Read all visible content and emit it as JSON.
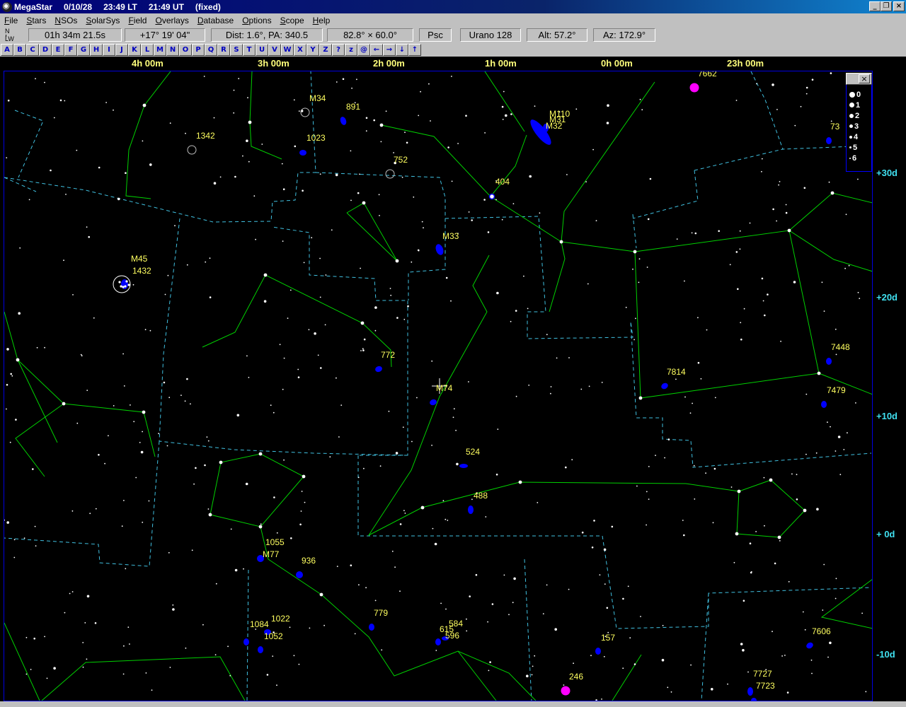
{
  "titlebar": {
    "app": "MegaStar",
    "date": "0/10/28",
    "local_time": "23:49 LT",
    "ut_time": "21:49 UT",
    "mode": "(fixed)",
    "minimize": "_",
    "restore": "❐",
    "close": "×"
  },
  "menu": [
    {
      "label": "File",
      "u": "F",
      "rest": "ile"
    },
    {
      "label": "Stars",
      "u": "S",
      "rest": "tars"
    },
    {
      "label": "NSOs",
      "u": "N",
      "rest": "SOs"
    },
    {
      "label": "SolarSys",
      "u": "S",
      "rest": "olarSys"
    },
    {
      "label": "Field",
      "u": "F",
      "rest": "ield"
    },
    {
      "label": "Overlays",
      "u": "O",
      "rest": "verlays"
    },
    {
      "label": "Database",
      "u": "D",
      "rest": "atabase"
    },
    {
      "label": "Options",
      "u": "O",
      "rest": "ptions"
    },
    {
      "label": "Scope",
      "u": "S",
      "rest": "cope"
    },
    {
      "label": "Help",
      "u": "H",
      "rest": "elp"
    }
  ],
  "status": {
    "compass_n": "N",
    "compass_lw": "LW",
    "ra": "01h 34m 21.5s",
    "dec": "+17° 19' 04\"",
    "dist": "Dist: 1.6°, PA: 340.5",
    "fov": "82.8° × 60.0°",
    "constellation": "Psc",
    "atlas": "Urano 128",
    "alt": "Alt: 57.2°",
    "az": "Az: 172.9°"
  },
  "alpha_buttons": [
    "A",
    "B",
    "C",
    "D",
    "E",
    "F",
    "G",
    "H",
    "I",
    "J",
    "K",
    "L",
    "M",
    "N",
    "O",
    "P",
    "Q",
    "R",
    "S",
    "T",
    "U",
    "V",
    "W",
    "X",
    "Y",
    "Z",
    "?",
    "z",
    "@",
    "←",
    "→",
    "↓",
    "↑"
  ],
  "ra_labels": [
    "4h 00m",
    "3h 00m",
    "2h 00m",
    "1h 00m",
    "0h 00m",
    "23h 00m"
  ],
  "dec_labels": [
    "+30d",
    "+20d",
    "+10d",
    "+ 0d",
    "-10d"
  ],
  "magnitude_legend": [
    "0",
    "1",
    "2",
    "3",
    "4",
    "5",
    "6"
  ],
  "objects": [
    {
      "label": "7662"
    },
    {
      "label": "M34"
    },
    {
      "label": "891"
    },
    {
      "label": "M110"
    },
    {
      "label": "M31"
    },
    {
      "label": "M32"
    },
    {
      "label": "1342"
    },
    {
      "label": "1023"
    },
    {
      "label": "752"
    },
    {
      "label": "404"
    },
    {
      "label": "73"
    },
    {
      "label": "M33"
    },
    {
      "label": "M45"
    },
    {
      "label": "1432"
    },
    {
      "label": "772"
    },
    {
      "label": "7448"
    },
    {
      "label": "7814"
    },
    {
      "label": "M74"
    },
    {
      "label": "7479"
    },
    {
      "label": "524"
    },
    {
      "label": "488"
    },
    {
      "label": "1055"
    },
    {
      "label": "M77"
    },
    {
      "label": "936"
    },
    {
      "label": "779"
    },
    {
      "label": "1022"
    },
    {
      "label": "1084"
    },
    {
      "label": "1052"
    },
    {
      "label": "584"
    },
    {
      "label": "615"
    },
    {
      "label": "596"
    },
    {
      "label": "157"
    },
    {
      "label": "7606"
    },
    {
      "label": "246"
    },
    {
      "label": "7727"
    },
    {
      "label": "7723"
    }
  ],
  "colors": {
    "background": "#000000",
    "constellation_line": "#00d000",
    "boundary": "#40c0e0",
    "galaxy": "#0000ff",
    "planetary_nebula": "#ff00ff",
    "label": "#ffff60",
    "axis_ra": "#ffff7c",
    "axis_dec": "#40e0f0"
  }
}
